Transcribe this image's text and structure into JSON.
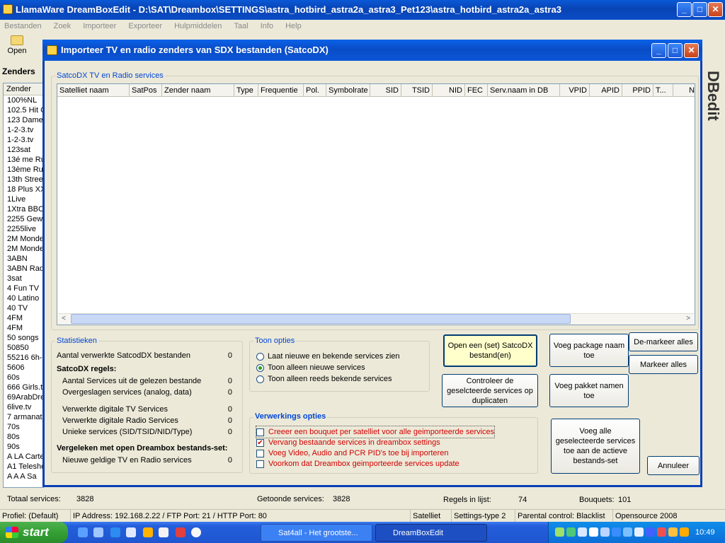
{
  "main_window": {
    "title": "LlamaWare DreamBoxEdit - D:\\SAT\\Dreambox\\SETTINGS\\astra_hotbird_astra2a_astra3_Pet123\\astra_hotbird_astra2a_astra3",
    "minimize": "_",
    "maximize": "□",
    "close": "✕"
  },
  "menu": [
    "Bestanden",
    "Zoek",
    "Importeer",
    "Exporteer",
    "Hulpmiddelen",
    "Taal",
    "Info",
    "Help"
  ],
  "toolbar": {
    "open_label": "Open"
  },
  "left_panel": {
    "title": "Zenders",
    "column_header": "Zender",
    "items": [
      "100%NL",
      "102.5 Hit C",
      "123 Damer",
      "1-2-3.tv",
      "1-2-3.tv",
      "123sat",
      "13é me Ru",
      "13ème Rue",
      "13th Street",
      "18 Plus XX",
      "1Live",
      "1Xtra BBC",
      "2255 Gewi",
      "2255live",
      "2M Monde",
      "2M Monde",
      "3ABN",
      "3ABN Rad",
      "3sat",
      "4 Fun TV",
      "40 Latino",
      "40 TV",
      "4FM",
      "4FM",
      "50 songs",
      "50850",
      "55216 6h-2",
      "5606",
      "60s",
      "666 Girls.tv",
      "69ArabDre",
      "6live.tv",
      "7 armanat",
      "70s",
      "80s",
      "90s",
      "A LA Carte",
      "A1 Telesho",
      "A A A Sa"
    ]
  },
  "right_logo": "DBedit",
  "dialog": {
    "title": "Importeer TV en radio zenders van SDX bestanden (SatcoDX)",
    "minimize": "_",
    "maximize": "□",
    "close": "✕",
    "services_group_label": "SatcoDX TV en Radio services",
    "columns": [
      "Satelliet naam",
      "SatPos",
      "Zender naam",
      "Type",
      "Frequentie",
      "Pol.",
      "Symbolrate",
      "SID",
      "TSID",
      "NID",
      "FEC",
      "Serv.naam in DB",
      "VPID",
      "APID",
      "PPID",
      "T...",
      "Na"
    ],
    "scroll_left": "<",
    "scroll_right": ">",
    "statistics": {
      "label": "Statistieken",
      "processed_files_label": "Aantal verwerkte SatcodDX bestanden",
      "processed_files_value": "0",
      "rules_heading": "SatcoDX regels:",
      "rows": [
        {
          "label": "Aantal Services uit de gelezen bestande",
          "value": "0"
        },
        {
          "label": "Overgeslagen services (analog, data)",
          "value": "0"
        },
        {
          "label": "Verwerkte digitale TV Services",
          "value": "0"
        },
        {
          "label": "Verwerkte digitale Radio Services",
          "value": "0"
        },
        {
          "label": "Unieke services (SID/TSID/NID/Type)",
          "value": "0"
        }
      ],
      "compare_heading": "Vergeleken met open Dreambox bestands-set:",
      "new_valid_label": "Nieuwe geldige TV en Radio services",
      "new_valid_value": "0"
    },
    "show_options": {
      "label": "Toon opties",
      "options": [
        "Laat nieuwe en bekende services zien",
        "Toon alleen nieuwe services",
        "Toon alleen reeds bekende services"
      ],
      "selected_index": 1
    },
    "processing_options": {
      "label": "Verwerkings opties",
      "options": [
        {
          "label": "Creeer een bouquet per satelliet voor alle geimporteerde services",
          "checked": false
        },
        {
          "label": "Vervang bestaande services in dreambox settings",
          "checked": true
        },
        {
          "label": "Voeg Video, Audio and PCR PID's toe bij importeren",
          "checked": false
        },
        {
          "label": "Voorkom dat Dreambox geimporteerde services update",
          "checked": false
        }
      ]
    },
    "buttons": {
      "open_satcodx": "Open een (set) SatcoDX bestand(en)",
      "check_duplicates": "Controleer de geselcteerde services op duplicaten",
      "add_package_name": "Voeg package naam toe",
      "add_package_names": "Voeg pakket namen toe",
      "deselect_all": "De-markeer alles",
      "select_all": "Markeer alles",
      "add_selected": "Voeg alle geselecteerde services toe aan de actieve bestands-set",
      "cancel": "Annuleer"
    }
  },
  "status_line": {
    "total_label": "Totaal services:",
    "total_value": "3828",
    "shown_label": "Getoonde services:",
    "shown_value": "3828",
    "rules_label": "Regels in lijst:",
    "rules_value": "74",
    "bouquets_label": "Bouquets:",
    "bouquets_value": "101"
  },
  "status_bar": {
    "profile": "Profiel: (Default)",
    "connection": "IP Address: 192.168.2.22 / FTP Port: 21 / HTTP Port: 80",
    "satellite": "Satelliet",
    "settings_type": "Settings-type 2",
    "parental": "Parental control: Blacklist",
    "opensource": "Opensource 2008"
  },
  "taskbar": {
    "start_label": "start",
    "tasks": [
      "Sat4all - Het grootste...",
      "DreamBoxEdit"
    ],
    "clock": "10:49"
  }
}
